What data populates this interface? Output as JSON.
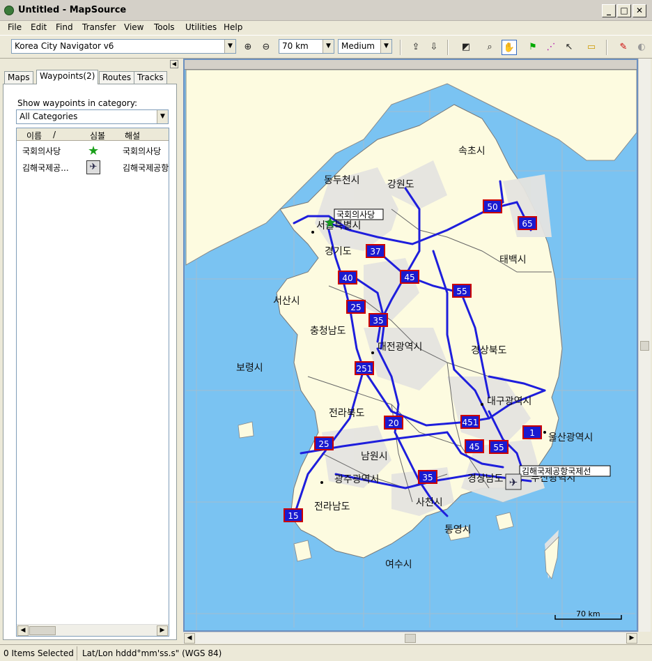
{
  "window": {
    "title": "Untitled - MapSource",
    "min": "_",
    "max": "□",
    "close": "✕"
  },
  "menu": [
    "File",
    "Edit",
    "Find",
    "Transfer",
    "View",
    "Tools",
    "Utilities",
    "Help"
  ],
  "toolbar": {
    "product": "Korea City Navigator v6",
    "zoom": "70 km",
    "detail": "Medium"
  },
  "tabs": {
    "maps": "Maps",
    "waypoints": "Waypoints(2)",
    "routes": "Routes",
    "tracks": "Tracks"
  },
  "panel": {
    "category_label": "Show waypoints in category:",
    "category_value": "All Categories",
    "columns": {
      "name": "이름",
      "sort": "/",
      "symbol": "심볼",
      "comment": "해설"
    },
    "rows": [
      {
        "name": "국회의사당",
        "comment": "국회의사당",
        "symbol": "green-star-icon"
      },
      {
        "name": "김해국제공...",
        "comment": "김해국제공항",
        "symbol": "airplane-icon"
      }
    ]
  },
  "map": {
    "labels": [
      "속초시",
      "동두천시",
      "강원도",
      "태백시",
      "경기도",
      "서산시",
      "충청남도",
      "대전광역시",
      "경상북도",
      "보령시",
      "대구광역시",
      "전라북도",
      "울산광역시",
      "남원시",
      "경상남도",
      "부산광역시",
      "광주광역시",
      "사천시",
      "전라남도",
      "통영시",
      "여수시"
    ],
    "seoul_label": "서울특별시",
    "highways": [
      "50",
      "65",
      "37",
      "40",
      "45",
      "55",
      "25",
      "35",
      "251",
      "451",
      "20",
      "1",
      "45",
      "55",
      "25",
      "35",
      "15"
    ],
    "waypoint_tags": {
      "assembly": "국회의사당",
      "airport": "김해국제공항국제선"
    },
    "scale": "70 km"
  },
  "status": {
    "selected": "0 Items Selected",
    "coords": "Lat/Lon hddd°mm'ss.s\" (WGS 84)"
  }
}
